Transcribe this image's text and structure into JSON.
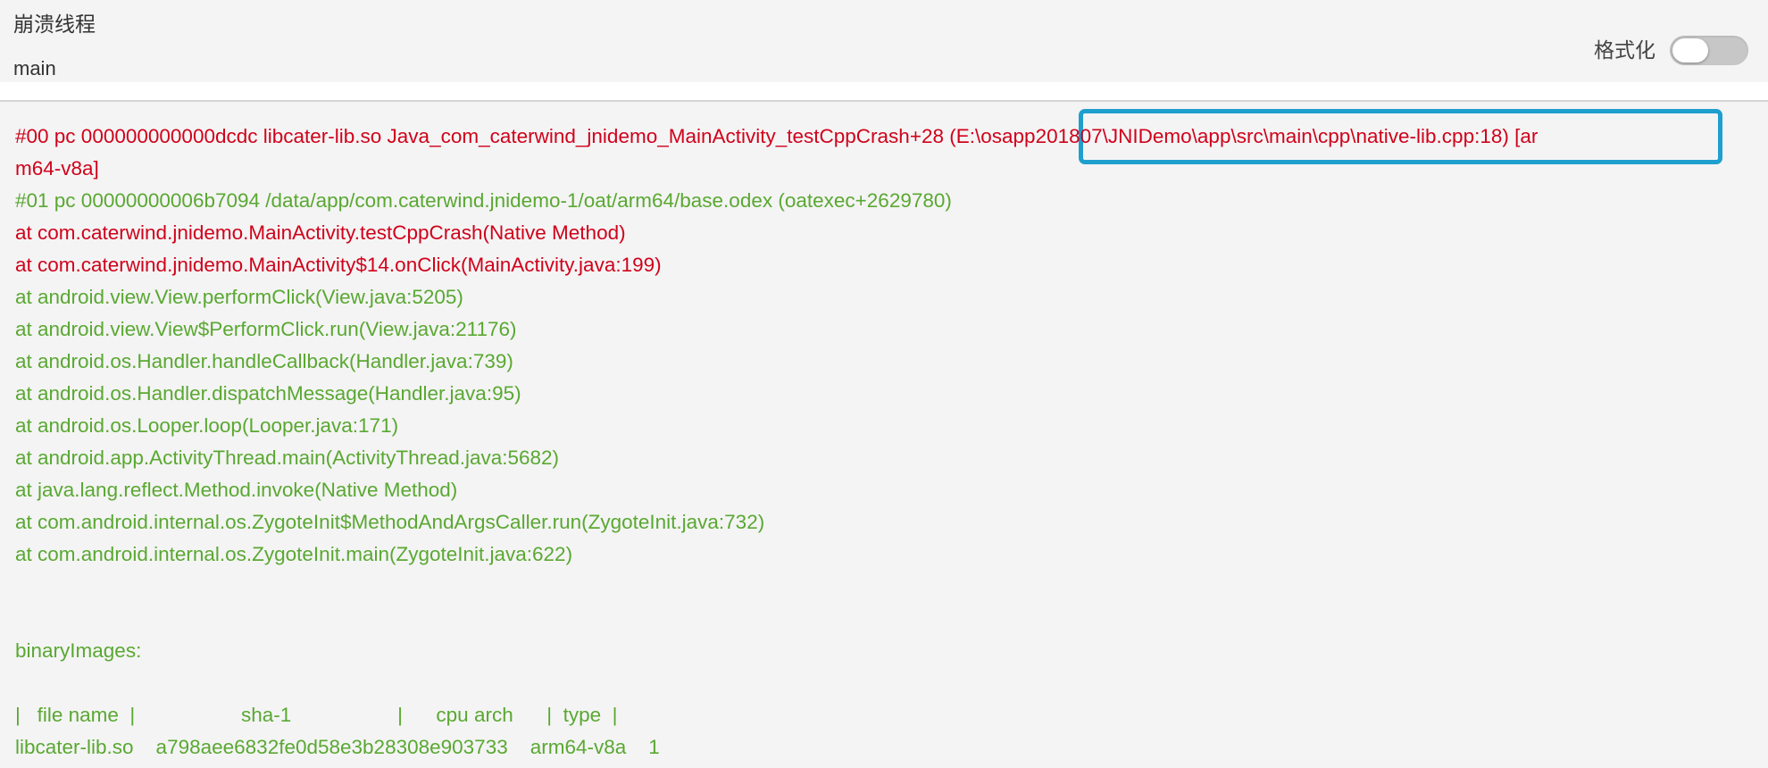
{
  "header": {
    "thread_title": "崩溃线程",
    "thread_name": "main",
    "format_label": "格式化",
    "format_enabled": false
  },
  "stack": {
    "line0_main": "#00 pc 000000000000dcdc libcater-lib.so Java_com_caterwind_jnidemo_MainActivity_testCppCrash+28",
    "line0_path": "(E:\\osapp201807\\JNIDemo\\app\\src\\main\\cpp\\native-lib.cpp:18)",
    "line0_arch_start": "[ar",
    "line0_arch_end": "m64-v8a]",
    "frames": [
      {
        "text": "#01 pc 00000000006b7094 /data/app/com.caterwind.jnidemo-1/oat/arm64/base.odex (oatexec+2629780)",
        "color": "green"
      },
      {
        "text": "at com.caterwind.jnidemo.MainActivity.testCppCrash(Native Method)",
        "color": "red"
      },
      {
        "text": "at com.caterwind.jnidemo.MainActivity$14.onClick(MainActivity.java:199)",
        "color": "red"
      },
      {
        "text": "at android.view.View.performClick(View.java:5205)",
        "color": "green"
      },
      {
        "text": "at android.view.View$PerformClick.run(View.java:21176)",
        "color": "green"
      },
      {
        "text": "at android.os.Handler.handleCallback(Handler.java:739)",
        "color": "green"
      },
      {
        "text": "at android.os.Handler.dispatchMessage(Handler.java:95)",
        "color": "green"
      },
      {
        "text": "at android.os.Looper.loop(Looper.java:171)",
        "color": "green"
      },
      {
        "text": "at android.app.ActivityThread.main(ActivityThread.java:5682)",
        "color": "green"
      },
      {
        "text": "at java.lang.reflect.Method.invoke(Native Method)",
        "color": "green"
      },
      {
        "text": "at com.android.internal.os.ZygoteInit$MethodAndArgsCaller.run(ZygoteInit.java:732)",
        "color": "green"
      },
      {
        "text": "at com.android.internal.os.ZygoteInit.main(ZygoteInit.java:622)",
        "color": "green"
      }
    ]
  },
  "binary_images": {
    "title": "binaryImages:",
    "header": "|   file name  |                   sha-1                   |      cpu arch      |  type  |",
    "rows": [
      "libcater-lib.so    a798aee6832fe0d58e3b28308e903733    arm64-v8a    1"
    ]
  },
  "colors": {
    "red": "#d0021b",
    "green": "#5aa832",
    "highlight": "#1f9fce"
  }
}
